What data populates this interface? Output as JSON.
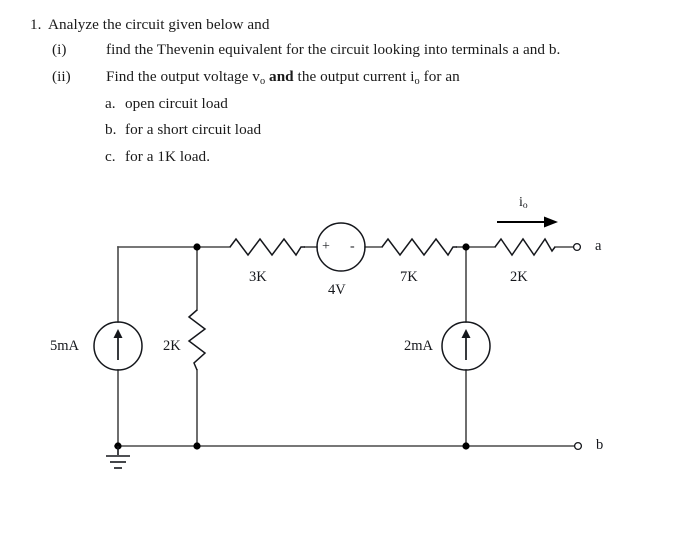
{
  "question": {
    "number": "1.",
    "stem": "Analyze the circuit given below and",
    "parts": [
      {
        "marker": "(i)",
        "text": "find the Thevenin equivalent for the circuit looking into terminals a and b."
      },
      {
        "marker": "(ii)",
        "text_before": "Find the output voltage v",
        "sub_1": "o",
        "text_bold": "and",
        "text_mid": "the output current i",
        "sub_2": "o",
        "text_after": "for an"
      }
    ],
    "subparts": [
      {
        "marker": "a.",
        "text": "open circuit load"
      },
      {
        "marker": "b.",
        "text": "for a short circuit load"
      },
      {
        "marker": "c.",
        "text": "for a 1K load."
      }
    ]
  },
  "circuit": {
    "title": "Thevenin equivalent circuit with two current sources and one voltage source",
    "components": [
      {
        "id": "src-5mA",
        "type": "current-source",
        "label": "5mA",
        "orientation": "vertical",
        "arrow": "up"
      },
      {
        "id": "res-2K-left",
        "type": "resistor",
        "label": "2K",
        "orientation": "vertical"
      },
      {
        "id": "res-3K",
        "type": "resistor",
        "label": "3K",
        "orientation": "horizontal"
      },
      {
        "id": "src-4V",
        "type": "voltage-source",
        "label": "4V",
        "orientation": "horizontal",
        "plus": "+",
        "minus": "-"
      },
      {
        "id": "res-7K",
        "type": "resistor",
        "label": "7K",
        "orientation": "horizontal"
      },
      {
        "id": "src-2mA",
        "type": "current-source",
        "label": "2mA",
        "orientation": "vertical",
        "arrow": "up"
      },
      {
        "id": "res-2K-right",
        "type": "resistor",
        "label": "2K",
        "orientation": "horizontal"
      }
    ],
    "terminals": [
      {
        "id": "terminal-a",
        "label": "a"
      },
      {
        "id": "terminal-b",
        "label": "b"
      }
    ],
    "current_arrow": {
      "id": "io-arrow",
      "label_text": "i",
      "label_sub": "o",
      "direction": "right"
    },
    "ground": {
      "id": "ground-symbol",
      "type": "earth-ground"
    },
    "colors": {
      "wire": "#4a4a4a",
      "component": "#15171c",
      "node": "#000000",
      "background": "#ffffff"
    }
  }
}
